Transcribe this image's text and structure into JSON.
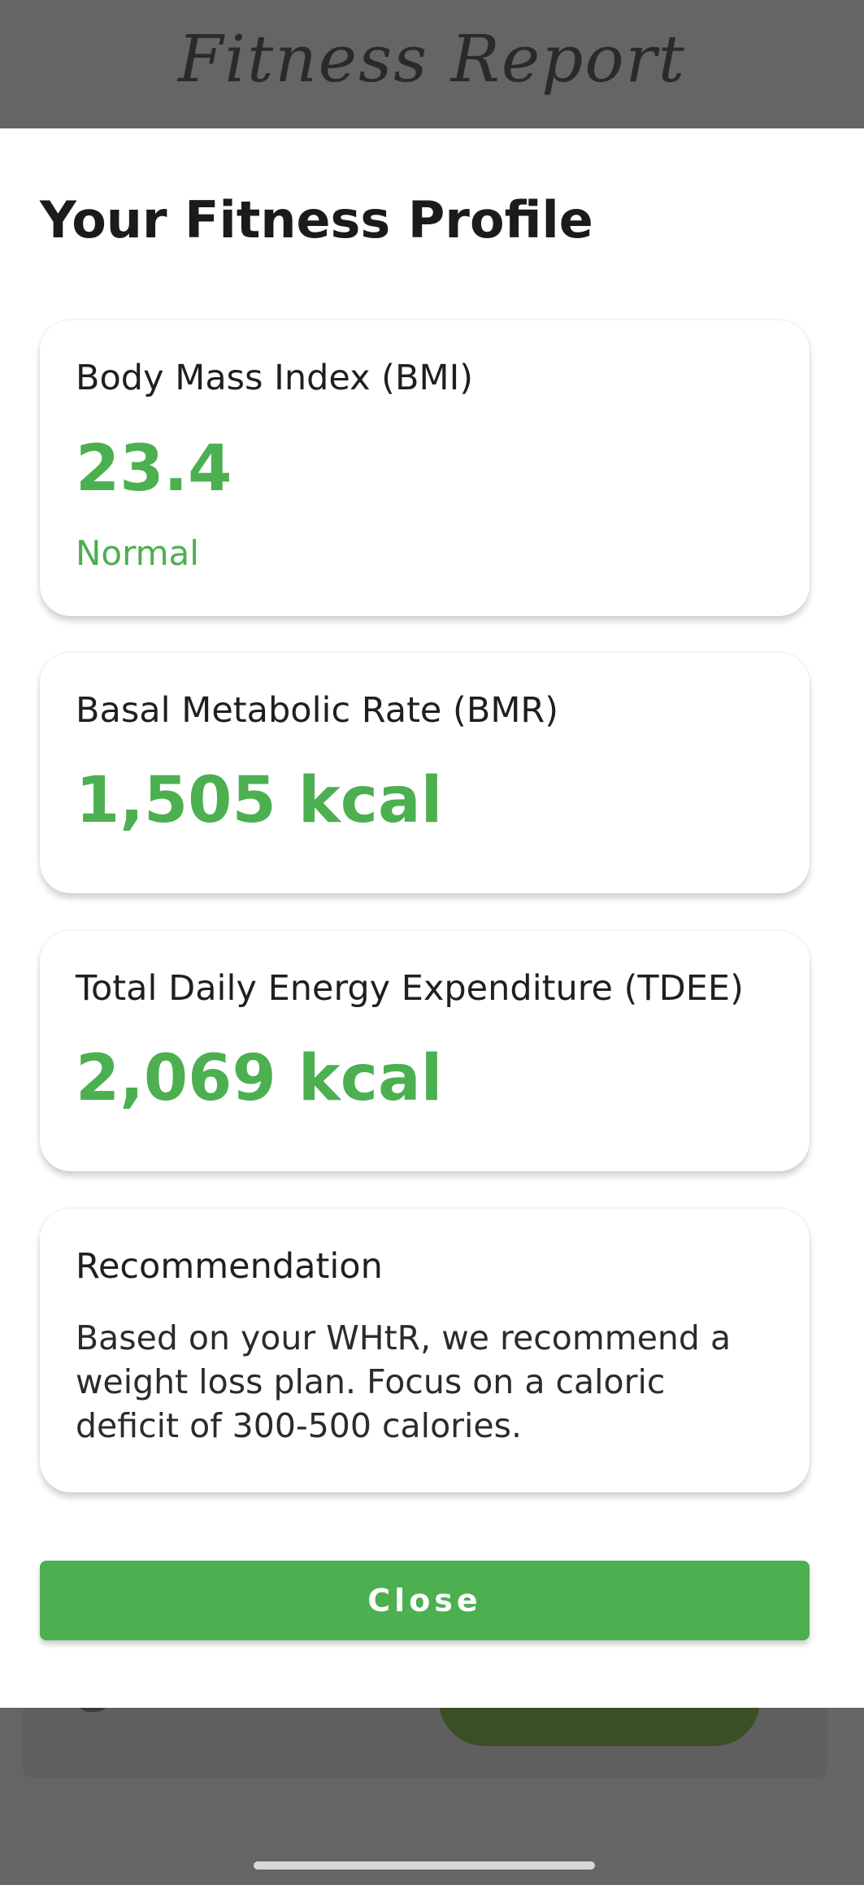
{
  "background": {
    "header_title": "Fitness Report"
  },
  "sheet": {
    "title": "Your Fitness Profile",
    "bmi": {
      "label": "Body Mass Index (BMI)",
      "value": "23.4",
      "status": "Normal"
    },
    "bmr": {
      "label": "Basal Metabolic Rate (BMR)",
      "value": "1,505 kcal"
    },
    "tdee": {
      "label": "Total Daily Energy Expenditure (TDEE)",
      "value": "2,069 kcal"
    },
    "recommendation": {
      "label": "Recommendation",
      "text": "Based on your WHtR, we recommend a weight loss plan. Focus on a caloric deficit of 300-500 calories."
    },
    "close_label": "Close"
  },
  "colors": {
    "accent": "#4caf50",
    "overlay": "#656565",
    "card_bg": "#ffffff"
  }
}
